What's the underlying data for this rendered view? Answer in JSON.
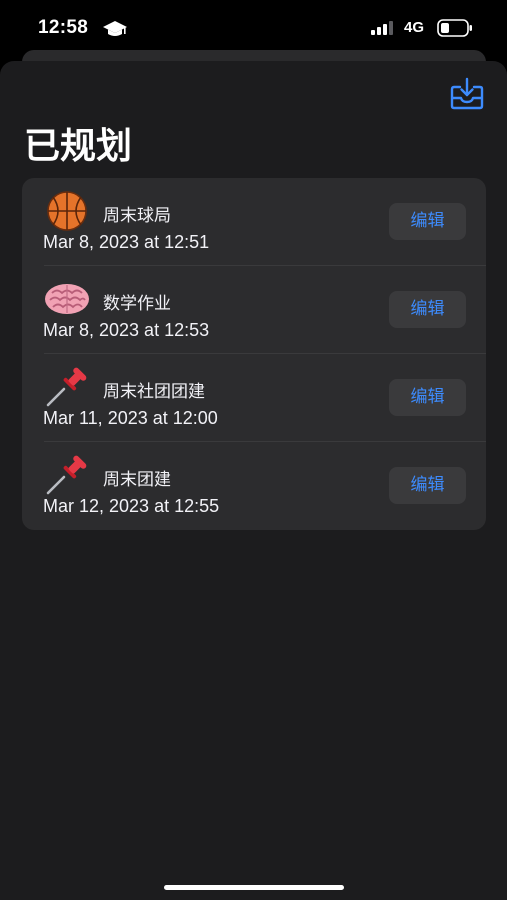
{
  "status_bar": {
    "time": "12:58",
    "network": "4G"
  },
  "header": {
    "title": "已规划",
    "export_icon": "tray-arrow-down-icon"
  },
  "plans": [
    {
      "icon": "basketball-icon",
      "title": "周末球局",
      "date": "Mar 8, 2023 at 12:51",
      "edit_label": "编辑"
    },
    {
      "icon": "brain-icon",
      "title": "数学作业",
      "date": "Mar 8, 2023 at 12:53",
      "edit_label": "编辑"
    },
    {
      "icon": "pushpin-icon",
      "title": "周末社团团建",
      "date": "Mar 11, 2023 at 12:00",
      "edit_label": "编辑"
    },
    {
      "icon": "pushpin-icon",
      "title": "周末团建",
      "date": "Mar 12, 2023 at 12:55",
      "edit_label": "编辑"
    }
  ],
  "colors": {
    "background": "#1c1c1e",
    "card": "#2c2c2e",
    "button": "#3a3a3c",
    "accent": "#3d8bfd"
  }
}
